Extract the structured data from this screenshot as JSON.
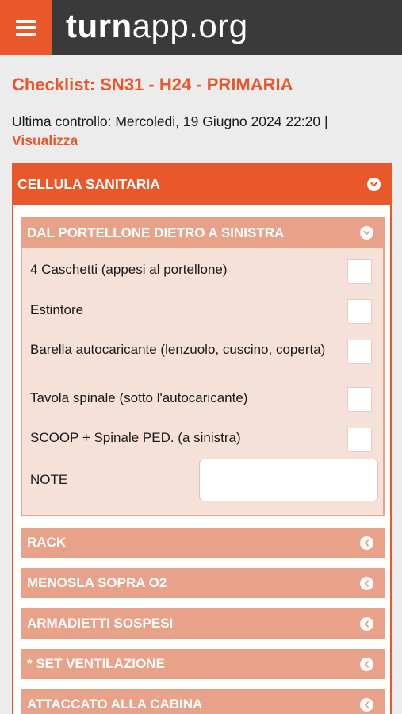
{
  "header": {
    "brand_bold": "turn",
    "brand_light": "app.org"
  },
  "page": {
    "title": "Checklist: SN31 - H24 - PRIMARIA",
    "last_check_prefix": "Ultima controllo: Mercoledi, 19 Giugno 2024 22:20 |",
    "view_link": "Visualizza"
  },
  "section": {
    "title": "CELLULA SANITARIA",
    "open_sub": {
      "title": "DAL PORTELLONE DIETRO A SINISTRA",
      "items": [
        "4 Caschetti (appesi al portellone)",
        "Estintore",
        "Barella autocaricante (lenzuolo, cuscino, coperta)",
        "Tavola spinale (sotto l'autocaricante)",
        "SCOOP + Spinale PED. (a sinistra)"
      ],
      "note_label": "NOTE",
      "note_value": ""
    },
    "closed_subs": [
      "RACK",
      "MENOSLA SOPRA O2",
      "ARMADIETTI SOSPESI",
      "* SET VENTILAZIONE",
      "ATTACCATO ALLA CABINA"
    ]
  },
  "colors": {
    "accent": "#e8582a",
    "sub_header": "#e9a28a",
    "topbar": "#3a3a3a"
  },
  "icons": {
    "menu": "hamburger-icon",
    "expanded": "chevron-down-circle-icon",
    "collapsed": "chevron-left-circle-icon"
  }
}
